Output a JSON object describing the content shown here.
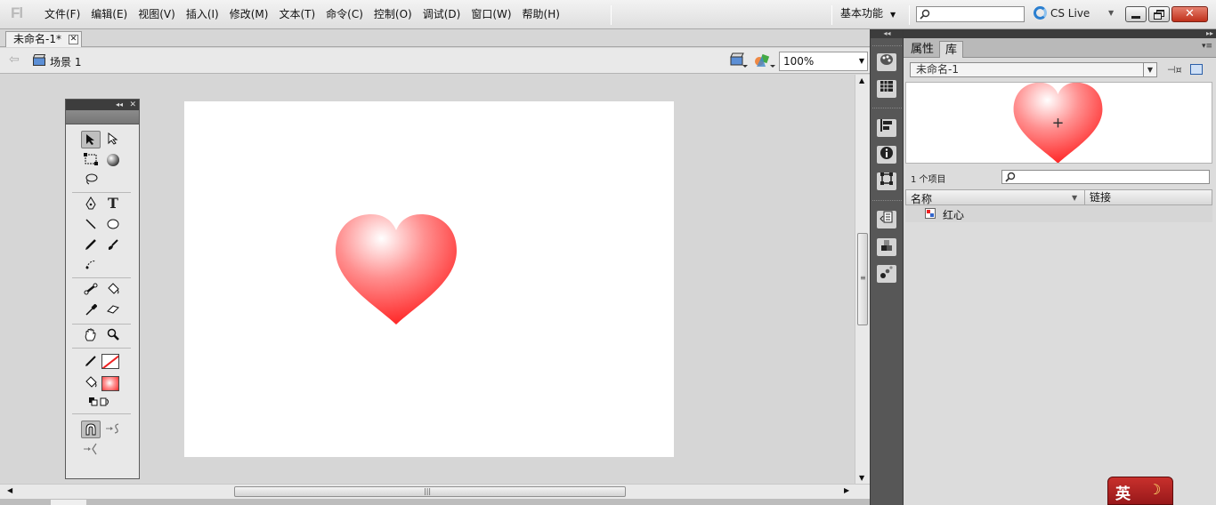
{
  "app": {
    "logo": "Fl"
  },
  "menu": [
    "文件(F)",
    "编辑(E)",
    "视图(V)",
    "插入(I)",
    "修改(M)",
    "文本(T)",
    "命令(C)",
    "控制(O)",
    "调试(D)",
    "窗口(W)",
    "帮助(H)"
  ],
  "workspace": {
    "label": "基本功能"
  },
  "cslive": {
    "label": "CS Live"
  },
  "window_controls": {
    "close": "✕"
  },
  "document": {
    "tab_label": "未命名-1*",
    "tab_close": "✕"
  },
  "scene": {
    "label": "场景 1"
  },
  "zoom": {
    "value": "100%"
  },
  "stage": {
    "heart_colors": {
      "highlight": "#ffffff",
      "mid": "#ff8f8f",
      "edge": "#ff1818"
    }
  },
  "tools": {
    "text_tool": "T"
  },
  "panel": {
    "tabs": [
      "属性",
      "库"
    ],
    "active_tab": "库",
    "doc_select": "未命名-1",
    "item_count": "1 个项目",
    "columns": {
      "name": "名称",
      "link": "链接"
    },
    "items": [
      {
        "name": "红心"
      }
    ]
  },
  "ime": {
    "label": "英"
  },
  "colors": {
    "accent": "#2b7fd0",
    "close": "#c0311b",
    "dock": "#575757"
  }
}
